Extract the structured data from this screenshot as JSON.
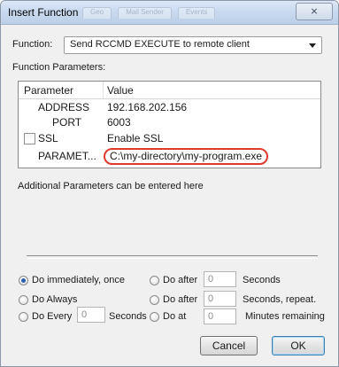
{
  "window": {
    "title": "Insert Function",
    "ghost_tabs": [
      "Geo",
      "Mail Sender",
      "Events"
    ],
    "close_label": "⨯"
  },
  "function": {
    "label": "Function:",
    "selected": "Send RCCMD EXECUTE to remote client"
  },
  "params_label": "Function Parameters:",
  "grid": {
    "headers": [
      "Parameter",
      "Value"
    ],
    "rows": [
      {
        "name": "ADDRESS",
        "value": "192.168.202.156"
      },
      {
        "name": "PORT",
        "value": "6003"
      },
      {
        "name": "SSL",
        "value": "Enable SSL",
        "checkbox": true,
        "checked": false
      },
      {
        "name": "PARAMET...",
        "value": "C:\\my-directory\\my-program.exe",
        "highlighted": true
      }
    ]
  },
  "additional_text": "Additional Parameters can be entered here",
  "schedule": {
    "do_immediately": "Do immediately, once",
    "do_always": "Do Always",
    "do_every": "Do Every",
    "every_value": "0",
    "every_unit": "Seconds",
    "do_after_1": "Do after",
    "after_1_value": "0",
    "after_1_unit": "Seconds",
    "do_after_2": "Do after",
    "after_2_value": "0",
    "after_2_unit": "Seconds, repeat.",
    "do_at": "Do at",
    "at_value": "0",
    "at_unit": "Minutes remaining",
    "selected": "do_immediately"
  },
  "buttons": {
    "cancel": "Cancel",
    "ok": "OK"
  },
  "colors": {
    "highlight_oval": "#e03a2f",
    "radio_dot": "#2a5db0"
  }
}
